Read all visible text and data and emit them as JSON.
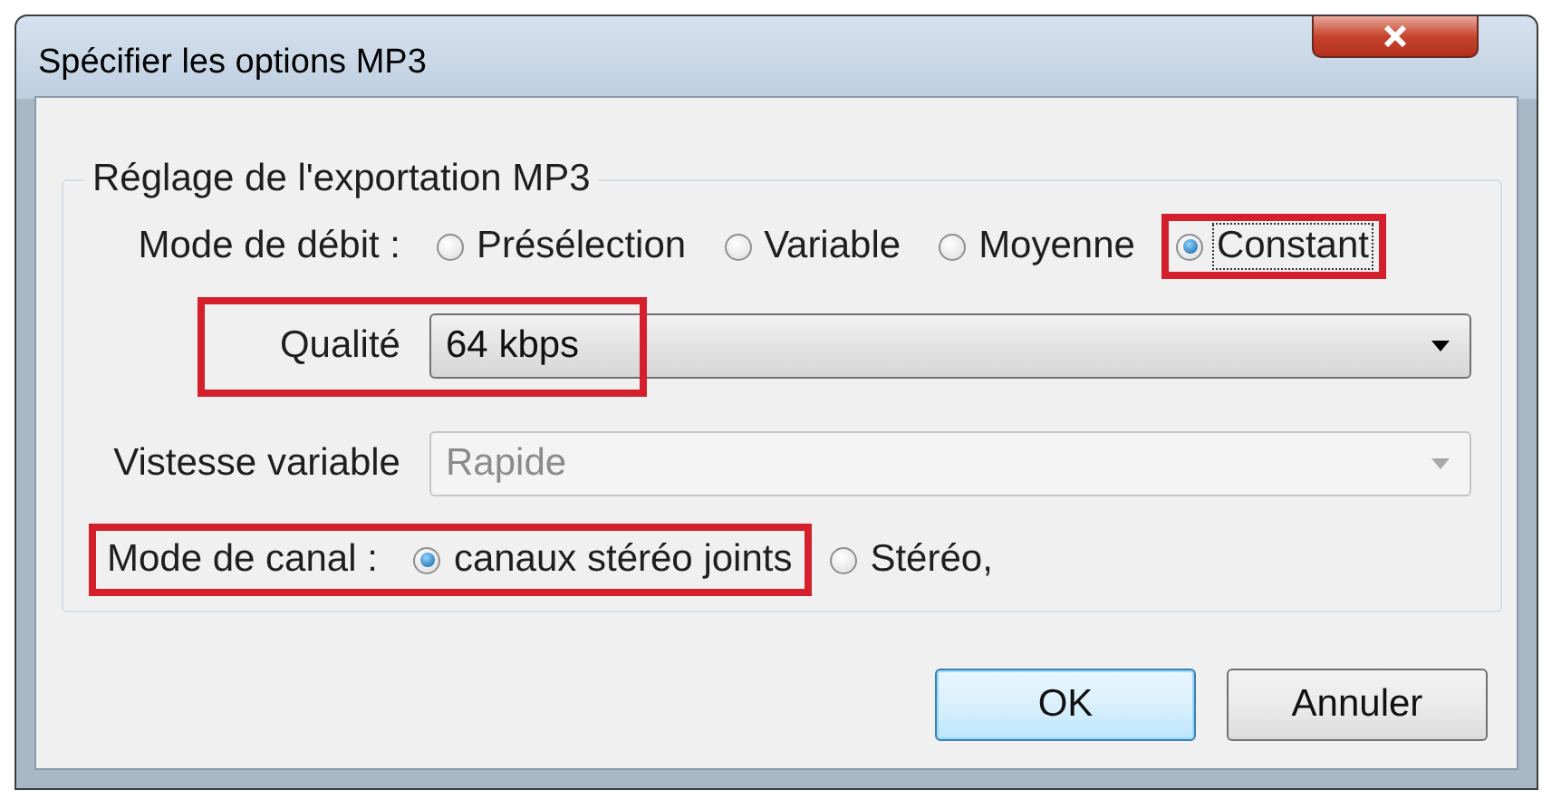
{
  "window": {
    "title": "Spécifier les options MP3"
  },
  "group": {
    "legend": "Réglage de l'exportation MP3",
    "bitrate_mode": {
      "label": "Mode de débit :",
      "options": [
        {
          "label": "Présélection",
          "selected": false,
          "focused": false,
          "highlighted": false
        },
        {
          "label": "Variable",
          "selected": false,
          "focused": false,
          "highlighted": false
        },
        {
          "label": "Moyenne",
          "selected": false,
          "focused": false,
          "highlighted": false
        },
        {
          "label": "Constant",
          "selected": true,
          "focused": true,
          "highlighted": true
        }
      ]
    },
    "quality": {
      "label": "Qualité",
      "value": "64 kbps",
      "disabled": false,
      "highlighted": true
    },
    "variable_speed": {
      "label": "Vistesse variable",
      "value": "Rapide",
      "disabled": true
    },
    "channel_mode": {
      "label": "Mode de canal :",
      "options": [
        {
          "label": "canaux stéréo joints",
          "selected": true,
          "focused": false,
          "highlighted": true
        },
        {
          "label": "Stéréo,",
          "selected": false,
          "focused": false,
          "highlighted": false
        }
      ]
    }
  },
  "buttons": [
    {
      "label": "OK",
      "default": true
    },
    {
      "label": "Annuler",
      "default": false
    }
  ]
}
